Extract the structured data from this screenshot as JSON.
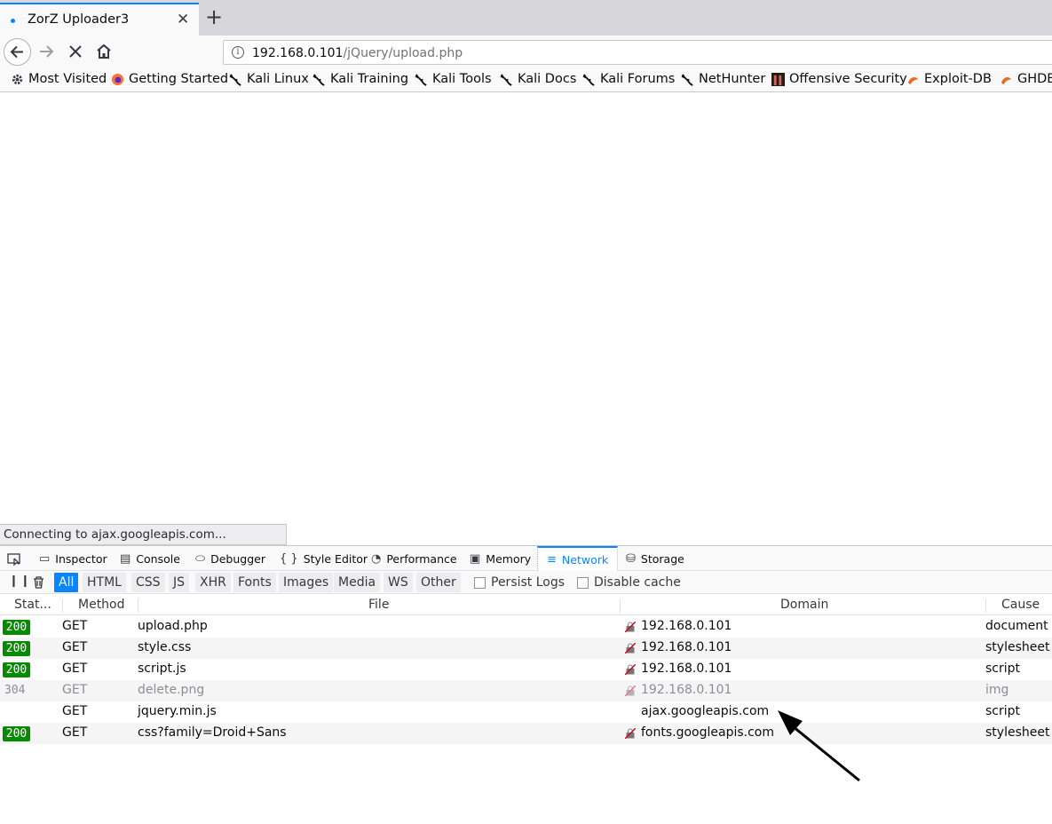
{
  "browser": {
    "tab_title": "ZorZ Uploader3",
    "url_host": "192.168.0.101",
    "url_path": "/jQuery/upload.php"
  },
  "bookmarks": [
    "Most Visited",
    "Getting Started",
    "Kali Linux",
    "Kali Training",
    "Kali Tools",
    "Kali Docs",
    "Kali Forums",
    "NetHunter",
    "Offensive Security",
    "Exploit-DB",
    "GHDB"
  ],
  "status_text": "Connecting to ajax.googleapis.com...",
  "devtools": {
    "tabs": [
      "Inspector",
      "Console",
      "Debugger",
      "Style Editor",
      "Performance",
      "Memory",
      "Network",
      "Storage"
    ],
    "selected_tab": "Network",
    "filters": [
      "All",
      "HTML",
      "CSS",
      "JS",
      "XHR",
      "Fonts",
      "Images",
      "Media",
      "WS",
      "Other"
    ],
    "persist_logs": "Persist Logs",
    "disable_cache": "Disable cache",
    "columns": {
      "status": "Stat...",
      "method": "Method",
      "file": "File",
      "domain": "Domain",
      "cause": "Cause"
    },
    "requests": [
      {
        "status": "200",
        "method": "GET",
        "file": "upload.php",
        "domain": "192.168.0.101",
        "cause": "document"
      },
      {
        "status": "200",
        "method": "GET",
        "file": "style.css",
        "domain": "192.168.0.101",
        "cause": "stylesheet"
      },
      {
        "status": "200",
        "method": "GET",
        "file": "script.js",
        "domain": "192.168.0.101",
        "cause": "script"
      },
      {
        "status": "304",
        "method": "GET",
        "file": "delete.png",
        "domain": "192.168.0.101",
        "cause": "img"
      },
      {
        "status": "",
        "method": "GET",
        "file": "jquery.min.js",
        "domain": "ajax.googleapis.com",
        "cause": "script"
      },
      {
        "status": "200",
        "method": "GET",
        "file": "css?family=Droid+Sans",
        "domain": "fonts.googleapis.com",
        "cause": "stylesheet"
      }
    ]
  },
  "colors": {
    "accent": "#0a84ff",
    "status_ok": "#058b00"
  }
}
